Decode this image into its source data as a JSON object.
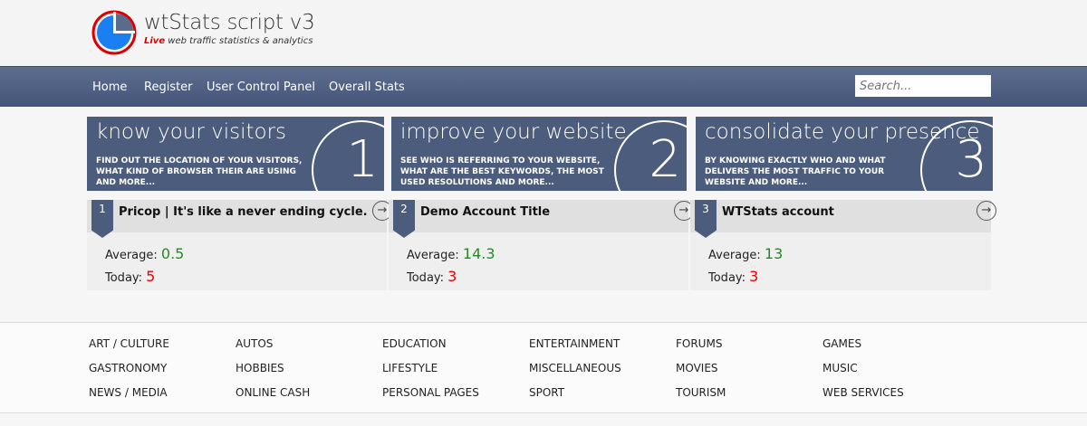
{
  "header": {
    "title": "wtStats script v3",
    "tagline_live": "Live",
    "tagline_rest": " web traffic statistics & analytics"
  },
  "nav": {
    "items": [
      "Home",
      "Register",
      "User Control Panel",
      "Overall Stats"
    ],
    "search_placeholder": "Search..."
  },
  "banners": [
    {
      "title": "know your visitors",
      "text": "FIND OUT THE LOCATION OF YOUR VISITORS, WHAT KIND OF BROWSER THEIR ARE USING AND MORE...",
      "number": "1"
    },
    {
      "title": "improve your website",
      "text": "SEE WHO IS REFERRING TO YOUR WEBSITE, WHAT ARE THE BEST KEYWORDS, THE MOST USED RESOLUTIONS AND MORE...",
      "number": "2"
    },
    {
      "title": "consolidate your presence",
      "text": "BY KNOWING EXACTLY WHO AND WHAT DELIVERS THE MOST TRAFFIC TO YOUR WEBSITE AND MORE...",
      "number": "3"
    }
  ],
  "cards": [
    {
      "rank": "1",
      "title": "Pricop | It's like a never ending cycle.",
      "average_label": "Average:",
      "average": "0.5",
      "today_label": "Today:",
      "today": "5"
    },
    {
      "rank": "2",
      "title": "Demo Account Title",
      "average_label": "Average:",
      "average": "14.3",
      "today_label": "Today:",
      "today": "3"
    },
    {
      "rank": "3",
      "title": "WTStats account",
      "average_label": "Average:",
      "average": "13",
      "today_label": "Today:",
      "today": "3"
    }
  ],
  "categories": [
    [
      "ART / CULTURE",
      "GASTRONOMY",
      "NEWS / MEDIA"
    ],
    [
      "AUTOS",
      "HOBBIES",
      "ONLINE CASH"
    ],
    [
      "EDUCATION",
      "LIFESTYLE",
      "PERSONAL PAGES"
    ],
    [
      "ENTERTAINMENT",
      "MISCELLANEOUS",
      "SPORT"
    ],
    [
      "FORUMS",
      "MOVIES",
      "TOURISM"
    ],
    [
      "GAMES",
      "MUSIC",
      "WEB SERVICES"
    ]
  ],
  "colors": {
    "nav": "#4c5c7c",
    "average": "#228b22",
    "today": "#e00000",
    "logo_blue": "#1a7ff0",
    "logo_red": "#d00000"
  }
}
